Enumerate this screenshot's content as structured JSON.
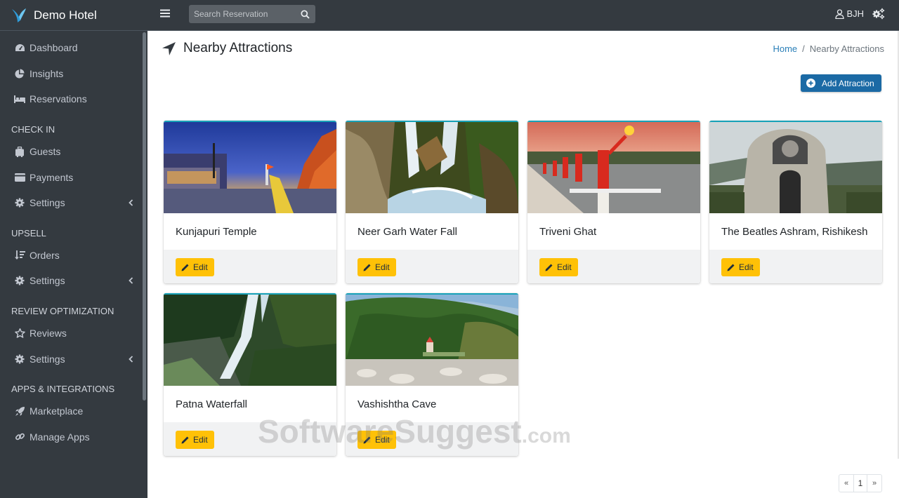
{
  "app": {
    "name": "Demo Hotel"
  },
  "sidebar": {
    "top_items": [
      {
        "label": "Dashboard",
        "icon": "tachometer-icon"
      },
      {
        "label": "Insights",
        "icon": "pie-chart-icon"
      },
      {
        "label": "Reservations",
        "icon": "bed-icon"
      }
    ],
    "sections": [
      {
        "header": "CHECK IN",
        "items": [
          {
            "label": "Guests",
            "icon": "suitcase-icon"
          },
          {
            "label": "Payments",
            "icon": "credit-card-icon"
          },
          {
            "label": "Settings",
            "icon": "gear-icon",
            "expandable": true
          }
        ]
      },
      {
        "header": "UPSELL",
        "items": [
          {
            "label": "Orders",
            "icon": "sort-icon"
          },
          {
            "label": "Settings",
            "icon": "gear-icon",
            "expandable": true
          }
        ]
      },
      {
        "header": "REVIEW OPTIMIZATION",
        "items": [
          {
            "label": "Reviews",
            "icon": "star-icon"
          },
          {
            "label": "Settings",
            "icon": "gear-icon",
            "expandable": true
          }
        ]
      },
      {
        "header": "APPS & INTEGRATIONS",
        "items": [
          {
            "label": "Marketplace",
            "icon": "rocket-icon"
          },
          {
            "label": "Manage Apps",
            "icon": "link-icon"
          }
        ]
      }
    ]
  },
  "topbar": {
    "search_placeholder": "Search Reservation",
    "user_name": "BJH"
  },
  "page": {
    "title": "Nearby Attractions",
    "breadcrumb": {
      "home": "Home",
      "separator": "/",
      "current": "Nearby Attractions"
    },
    "add_button": "Add Attraction",
    "edit_label": "Edit"
  },
  "attractions": [
    {
      "name": "Kunjapuri Temple"
    },
    {
      "name": "Neer Garh Water Fall"
    },
    {
      "name": "Triveni Ghat"
    },
    {
      "name": "The Beatles Ashram, Rishikesh"
    },
    {
      "name": "Patna Waterfall"
    },
    {
      "name": "Vashishtha Cave"
    }
  ],
  "pagination": {
    "prev": "«",
    "page": "1",
    "next": "»"
  },
  "watermark": {
    "main": "SoftwareSuggest",
    "suffix": ".com"
  },
  "colors": {
    "sidebar_bg": "#343a40",
    "accent": "#1b6aa5",
    "edit": "#ffc107",
    "card_top": "#17a2b8"
  }
}
